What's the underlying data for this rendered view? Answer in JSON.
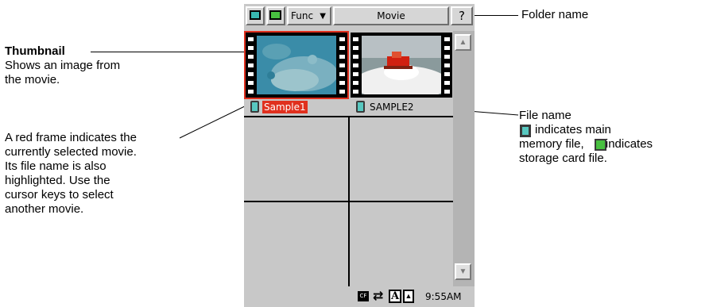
{
  "annotations": {
    "thumbnail_title": "Thumbnail",
    "thumbnail_desc_1": "Shows an image from",
    "thumbnail_desc_2": "the movie.",
    "selected_1": "A red frame indicates the",
    "selected_2": "currently selected movie.",
    "selected_3": "Its file name is also",
    "selected_4": "highlighted. Use the",
    "selected_5": "cursor keys to select",
    "selected_6": "another movie.",
    "folder_name": "Folder name",
    "file_name": "File name",
    "file_name_2": "indicates main",
    "file_name_3": "memory file,",
    "file_name_3b": "indicates",
    "file_name_4": "storage card file."
  },
  "toolbar": {
    "func_label": "Func",
    "folder_label": "Movie",
    "icons": [
      "screen-icon",
      "card-icon",
      "chevron-down-icon",
      "help-icon"
    ]
  },
  "files": [
    {
      "name": "Sample1",
      "selected": true,
      "storage": "main-memory"
    },
    {
      "name": "SAMPLE2",
      "selected": false,
      "storage": "main-memory"
    }
  ],
  "status": {
    "time": "9:55AM",
    "icons": [
      "cf-card-icon",
      "power-plug-icon",
      "keyboard-a-icon",
      "up-arrow-icon"
    ]
  },
  "colors": {
    "selection_red": "#e0301e",
    "screen_gray": "#c8c8c8",
    "memory_icon": "#58c8c0",
    "storage_icon": "#48c040"
  }
}
